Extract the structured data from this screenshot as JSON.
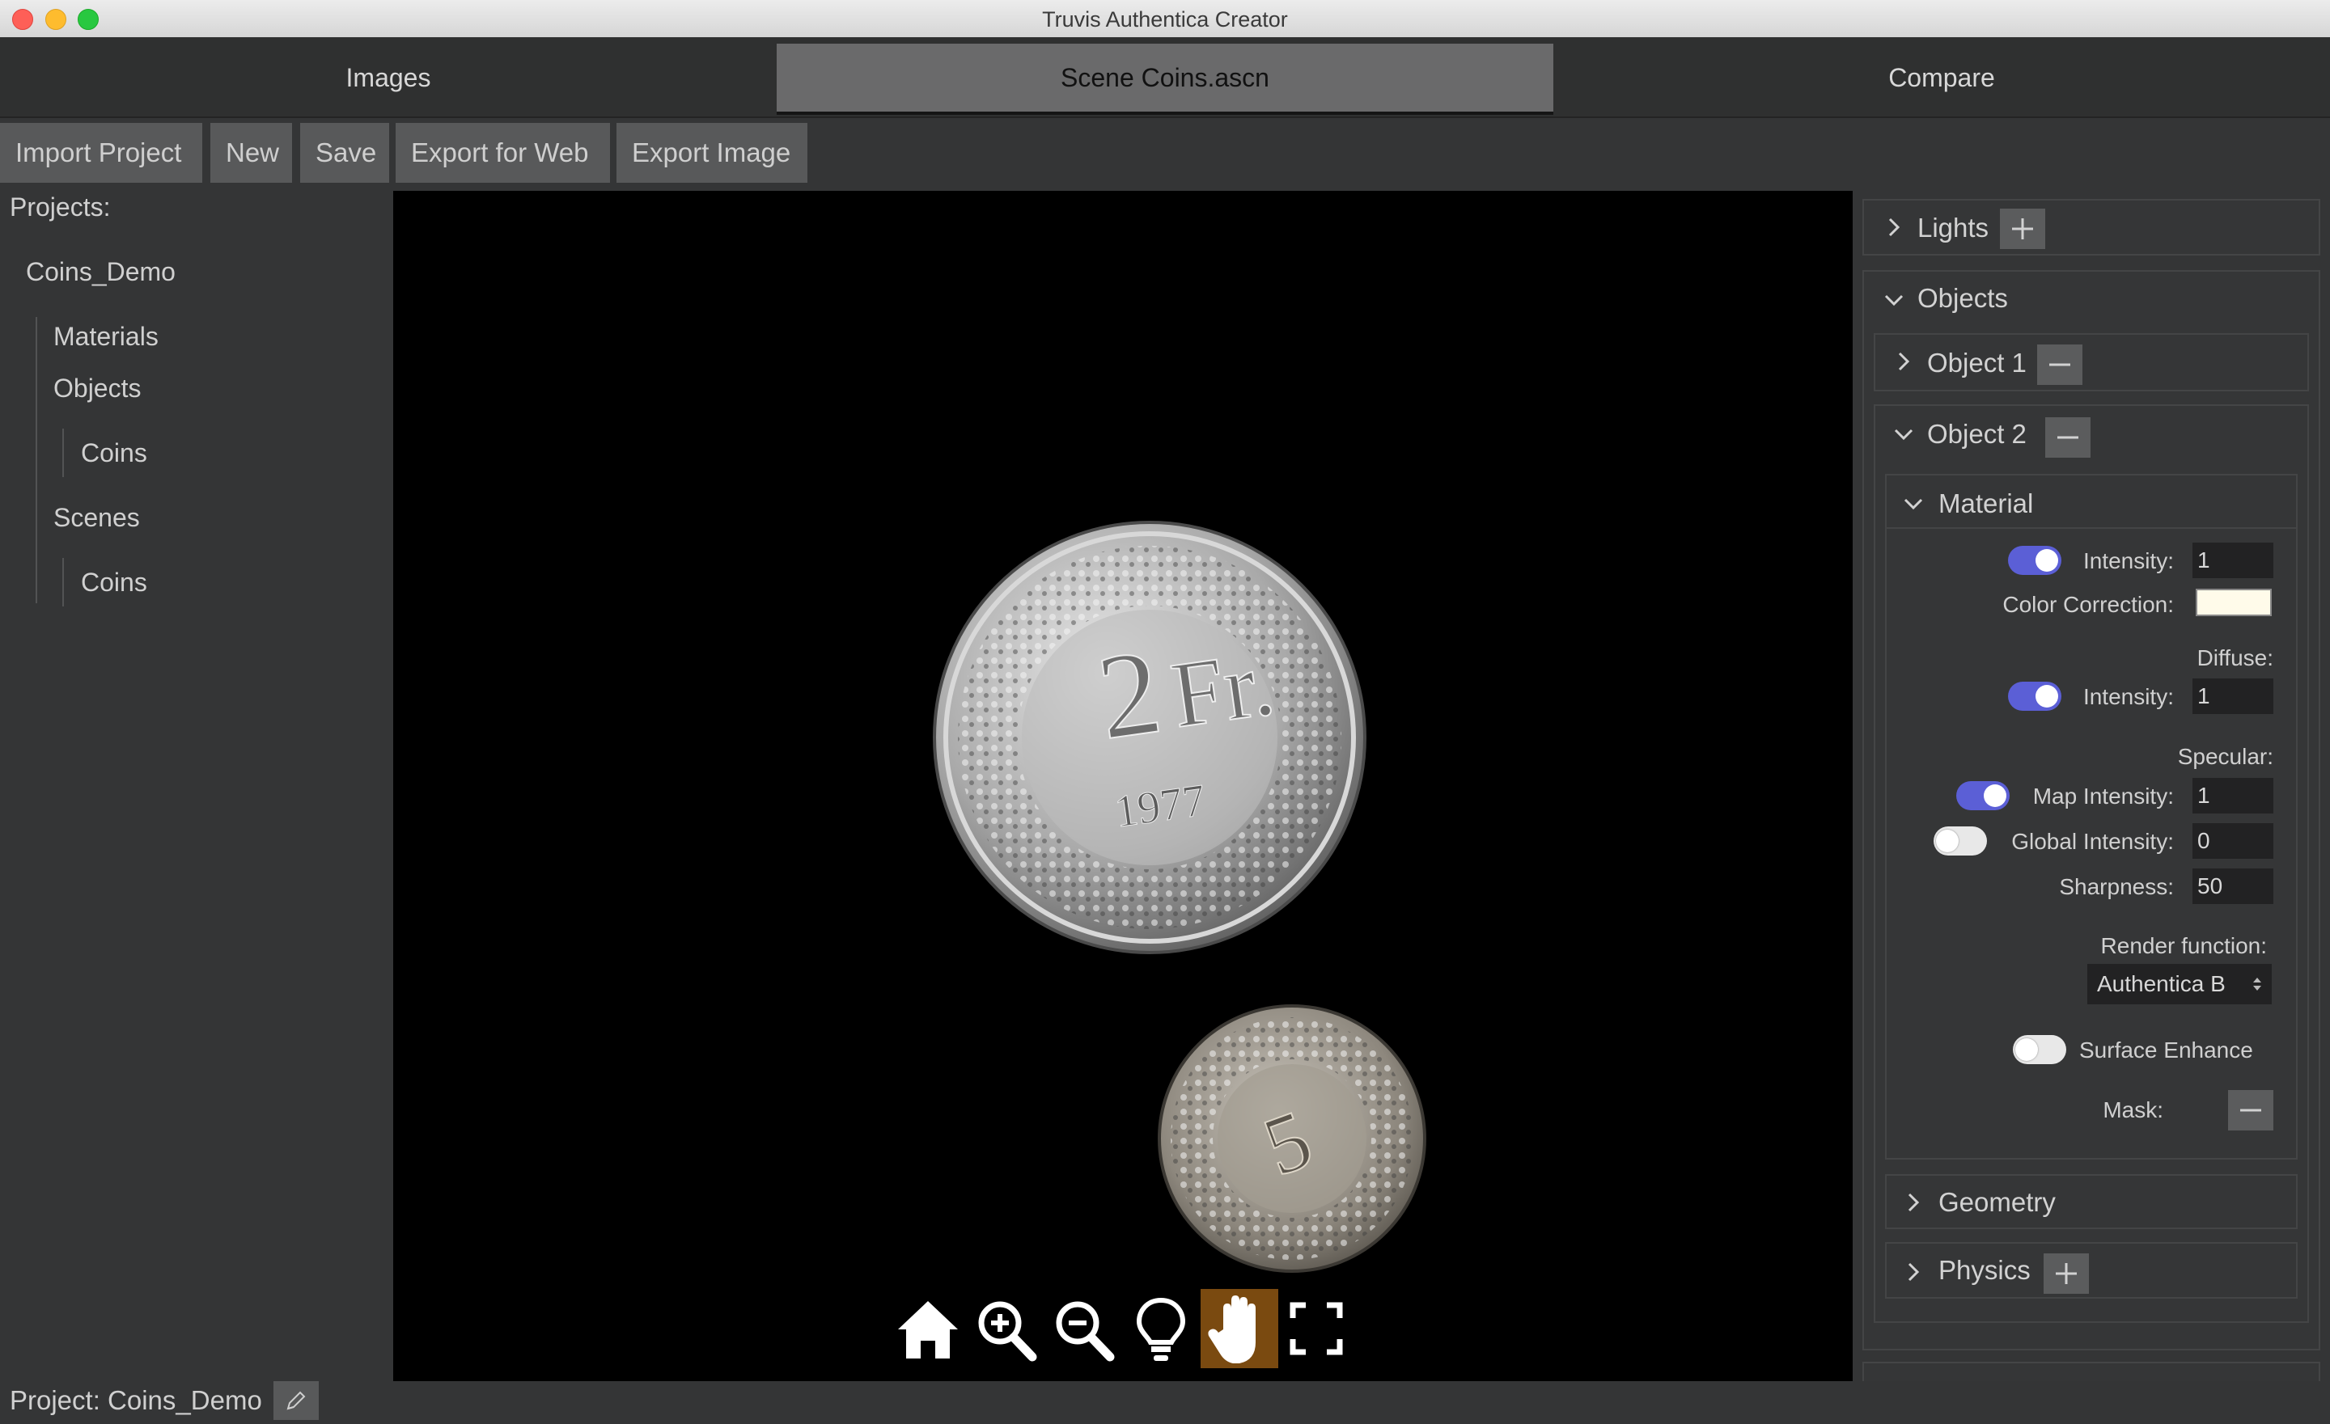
{
  "window": {
    "title": "Truvis Authentica Creator"
  },
  "tabs": [
    {
      "label": "Images",
      "active": false
    },
    {
      "label": "Scene Coins.ascn",
      "active": true
    },
    {
      "label": "Compare",
      "active": false
    }
  ],
  "toolbar": {
    "import_project": "Import Project",
    "new": "New",
    "save": "Save",
    "export_web": "Export for Web",
    "export_image": "Export Image"
  },
  "tree": {
    "heading": "Projects:",
    "project": "Coins_Demo",
    "materials": "Materials",
    "objects": "Objects",
    "objects_child": "Coins",
    "scenes": "Scenes",
    "scenes_child": "Coins"
  },
  "status": {
    "project_label": "Project: Coins_Demo"
  },
  "coins": {
    "coin1_value": "2",
    "coin1_unit": "Fr.",
    "coin1_year": "1977",
    "coin2_value": "5"
  },
  "viewer_tools": [
    "home-icon",
    "zoom-in-icon",
    "zoom-out-icon",
    "bulb-icon",
    "hand-icon",
    "fullscreen-icon"
  ],
  "right_panel": {
    "lights": "Lights",
    "objects": "Objects",
    "object1": "Object 1",
    "object2": "Object 2",
    "material": {
      "title": "Material",
      "intensity_label": "Intensity:",
      "intensity_value": "1",
      "intensity_on": true,
      "color_correction_label": "Color Correction:",
      "color_correction_value": "#fffbea",
      "diffuse_label": "Diffuse:",
      "diffuse_intensity_label": "Intensity:",
      "diffuse_intensity_value": "1",
      "diffuse_on": true,
      "specular_label": "Specular:",
      "map_intensity_label": "Map Intensity:",
      "map_intensity_value": "1",
      "map_on": true,
      "global_intensity_label": "Global Intensity:",
      "global_intensity_value": "0",
      "global_on": false,
      "sharpness_label": "Sharpness:",
      "sharpness_value": "50",
      "render_function_label": "Render function:",
      "render_function_value": "Authentica B",
      "surface_enhance_label": "Surface Enhance",
      "surface_on": false,
      "mask_label": "Mask:"
    },
    "geometry": "Geometry",
    "physics": "Physics"
  },
  "colors": {
    "toggle_on": "#5b5fd6",
    "active_tool": "#7a4a10",
    "background": "#343536"
  }
}
